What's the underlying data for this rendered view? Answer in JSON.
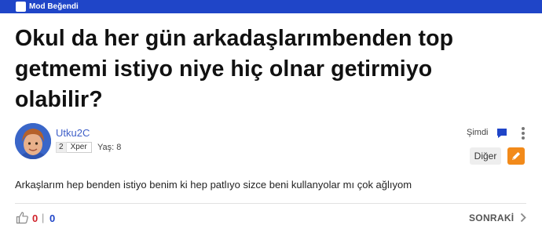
{
  "header": {
    "badge_label": "Mod Beğendi"
  },
  "question": {
    "title": "Okul da her gün arkadaşlarımbenden top getmemi istiyo niye hiç olnar getirmiyo olabilir?",
    "body": "Arkaşlarım hep benden istiyo benim ki hep patlıyo sizce beni kullanyolar mı çok ağlıyom"
  },
  "author": {
    "username": "Utku2C",
    "level_number": "2",
    "level_name": "Xper",
    "age": "Yaş: 8"
  },
  "meta": {
    "time": "Şimdi",
    "other_button": "Diğer"
  },
  "votes": {
    "likes": "0",
    "separator": "|",
    "dislikes": "0"
  },
  "nav": {
    "next_label": "SONRAKİ"
  },
  "colors": {
    "top_bar": "#1f45c8",
    "username": "#3f5fc8",
    "edit_button": "#f28a1a",
    "like_count": "#d0222a"
  },
  "icons": [
    "check-badge-icon",
    "chat-icon",
    "more-vertical-icon",
    "pencil-icon",
    "thumbs-up-icon",
    "chevron-right-icon"
  ]
}
